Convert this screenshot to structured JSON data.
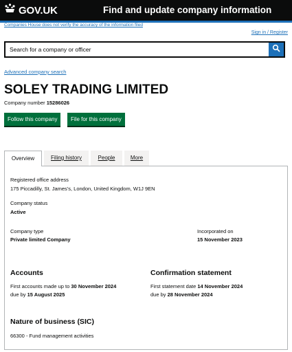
{
  "header": {
    "logo_text": "GOV.UK",
    "service_name": "Find and update company information",
    "disclaimer": "Companies House does not verify the accuracy of the information filed",
    "signin": "Sign in / Register"
  },
  "search": {
    "placeholder": "Search for a company or officer",
    "button_icon": "search-icon"
  },
  "advanced_search": "Advanced company search",
  "company": {
    "name": "SOLEY TRADING LIMITED",
    "number_label": "Company number",
    "number": "15286026"
  },
  "actions": {
    "follow": "Follow this company",
    "file": "File for this company"
  },
  "tabs": [
    {
      "label": "Overview",
      "active": true
    },
    {
      "label": "Filing history",
      "active": false
    },
    {
      "label": "People",
      "active": false
    },
    {
      "label": "More",
      "active": false
    }
  ],
  "overview": {
    "address_label": "Registered office address",
    "address": "175 Piccadilly, St. James's, London, United Kingdom, W1J 9EN",
    "status_label": "Company status",
    "status": "Active",
    "type_label": "Company type",
    "type": "Private limited Company",
    "incorporated_label": "Incorporated on",
    "incorporated": "15 November 2023",
    "accounts": {
      "heading": "Accounts",
      "first_prefix": "First accounts made up to",
      "first_date": "30 November 2024",
      "due_prefix": "due by",
      "due_date": "15 August 2025"
    },
    "confirmation": {
      "heading": "Confirmation statement",
      "first_prefix": "First statement date",
      "first_date": "14 November 2024",
      "due_prefix": "due by",
      "due_date": "28 November 2024"
    },
    "nature": {
      "heading": "Nature of business (SIC)",
      "item": "66300 - Fund management activities"
    }
  },
  "colors": {
    "header_bg": "#0b0c0c",
    "link": "#1d70b8",
    "button_green": "#00703c",
    "tab_inactive_bg": "#f3f2f1"
  }
}
